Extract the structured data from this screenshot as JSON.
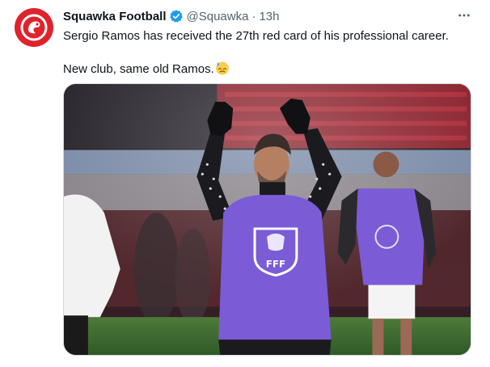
{
  "tweet": {
    "author_name": "Squawka Football",
    "author_handle": "@Squawka",
    "separator": "·",
    "timestamp": "13h",
    "text_line1": "Sergio Ramos has received the 27th red card of his professional career.",
    "text_line2": "New club, same old Ramos.",
    "emoji": "downcast-face-with-sweat"
  },
  "icons": {
    "avatar": "squawka-logo",
    "verified": "verified-badge-icon",
    "more": "more-options-icon"
  },
  "media": {
    "bib_crest_text": "FFF"
  },
  "colors": {
    "brand_red": "#e0222b",
    "verified_blue": "#1d9bf0",
    "bib_purple": "#7b5bd6",
    "text_secondary": "#536471"
  }
}
